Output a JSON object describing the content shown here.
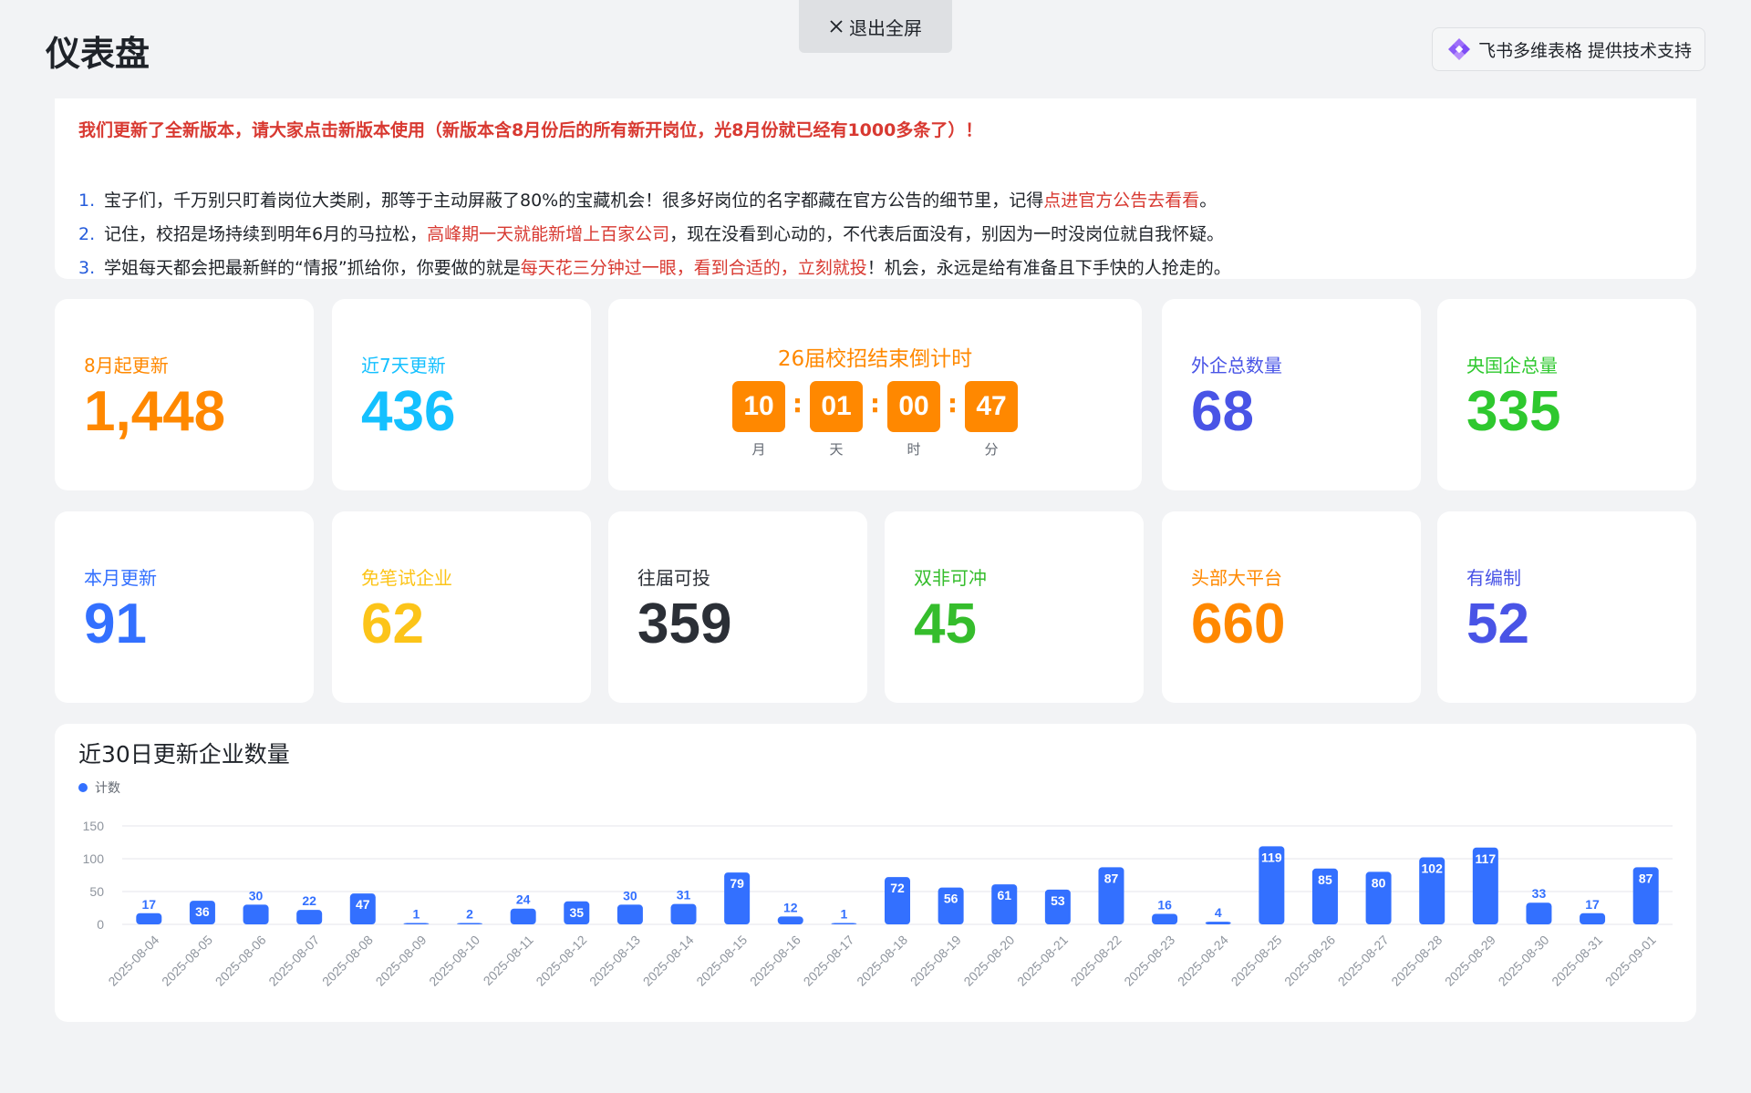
{
  "header": {
    "title": "仪表盘",
    "exit_fullscreen": "退出全屏",
    "powered_by": "飞书多维表格 提供技术支持"
  },
  "notice": {
    "headline": "我们更新了全新版本，请大家点击新版本使用（新版本含8月份后的所有新开岗位，光8月份就已经有1000多条了）！",
    "items": [
      {
        "num": "1.",
        "pre": "宝子们，千万别只盯着岗位大类刷，那等于主动屏蔽了80%的宝藏机会！很多好岗位的名字都藏在官方公告的细节里，记得",
        "hl": "点进官方公告去看看",
        "post": "。"
      },
      {
        "num": "2.",
        "pre": "记住，校招是场持续到明年6月的马拉松，",
        "hl": "高峰期一天就能新增上百家公司",
        "post": "，现在没看到心动的，不代表后面没有，别因为一时没岗位就自我怀疑。"
      },
      {
        "num": "3.",
        "pre": "学姐每天都会把最新鲜的“情报”抓给你，你要做的就是",
        "hl": "每天花三分钟过一眼，看到合适的，立刻就投",
        "post": "！机会，永远是给有准备且下手快的人抢走的。"
      }
    ]
  },
  "stats_row1": [
    {
      "label": "8月起更新",
      "value": "1,448",
      "color": "#ff8800"
    },
    {
      "label": "近7天更新",
      "value": "436",
      "color": "#14c0ff"
    },
    {
      "label": "外企总数量",
      "value": "68",
      "color": "#4954e6"
    },
    {
      "label": "央国企总量",
      "value": "335",
      "color": "#2ec82e"
    }
  ],
  "countdown": {
    "title": "26届校招结束倒计时",
    "units": [
      {
        "value": "10",
        "label": "月"
      },
      {
        "value": "01",
        "label": "天"
      },
      {
        "value": "00",
        "label": "时"
      },
      {
        "value": "47",
        "label": "分"
      }
    ],
    "sep": ":"
  },
  "stats_row2": [
    {
      "label": "本月更新",
      "value": "91",
      "color": "#3370ff"
    },
    {
      "label": "免笔试企业",
      "value": "62",
      "color": "#fcc419"
    },
    {
      "label": "往届可投",
      "value": "359",
      "color": "#2b2f36"
    },
    {
      "label": "双非可冲",
      "value": "45",
      "color": "#35bd2c"
    },
    {
      "label": "头部大平台",
      "value": "660",
      "color": "#ff8800"
    },
    {
      "label": "有编制",
      "value": "52",
      "color": "#4954e6"
    }
  ],
  "chart_data": {
    "type": "bar",
    "title": "近30日更新企业数量",
    "legend": [
      "计数"
    ],
    "legend_position": "top-left",
    "bar_color": "#3370ff",
    "grid": true,
    "ylim": [
      0,
      150
    ],
    "yticks": [
      0,
      50,
      100,
      150
    ],
    "categories": [
      "2025-08-04",
      "2025-08-05",
      "2025-08-06",
      "2025-08-07",
      "2025-08-08",
      "2025-08-09",
      "2025-08-10",
      "2025-08-11",
      "2025-08-12",
      "2025-08-13",
      "2025-08-14",
      "2025-08-15",
      "2025-08-16",
      "2025-08-17",
      "2025-08-18",
      "2025-08-19",
      "2025-08-20",
      "2025-08-21",
      "2025-08-22",
      "2025-08-23",
      "2025-08-24",
      "2025-08-25",
      "2025-08-26",
      "2025-08-27",
      "2025-08-28",
      "2025-08-29",
      "2025-08-30",
      "2025-08-31",
      "2025-09-01"
    ],
    "series": [
      {
        "name": "计数",
        "values": [
          17,
          36,
          30,
          22,
          47,
          1,
          2,
          24,
          35,
          30,
          31,
          79,
          12,
          1,
          72,
          56,
          61,
          53,
          87,
          16,
          4,
          119,
          85,
          80,
          102,
          117,
          33,
          17,
          87
        ]
      }
    ]
  }
}
